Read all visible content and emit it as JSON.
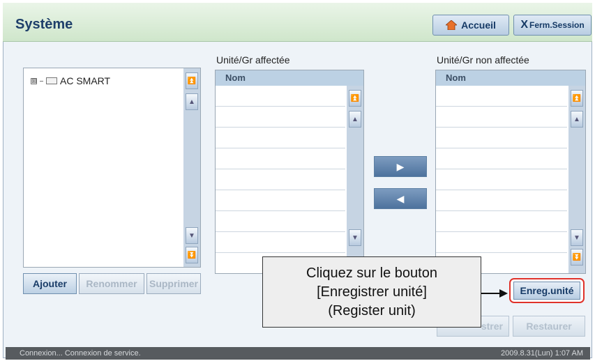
{
  "header": {
    "title": "Système",
    "home_label": "Accueil",
    "logout_prefix": "X",
    "logout_label": "Ferm.Session"
  },
  "tree": {
    "items": [
      {
        "label": "AC SMART",
        "expander": "⊞"
      }
    ]
  },
  "tree_buttons": {
    "add": "Ajouter",
    "rename": "Renommer",
    "delete": "Supprimer"
  },
  "assigned": {
    "label": "Unité/Gr affectée",
    "column": "Nom"
  },
  "unassigned": {
    "label": "Unité/Gr non affectée",
    "column": "Nom"
  },
  "move_buttons": {
    "right_icon": "▶",
    "left_icon": "◀"
  },
  "actions": {
    "register_unit": "Enreg.unité",
    "save_partial": "strer",
    "restore": "Restaurer"
  },
  "callout": {
    "line1": "Cliquez sur le bouton",
    "line2": "[Enregistrer unité]",
    "line3": "(Register unit)"
  },
  "status": {
    "left": "Connexion... Connexion de service.",
    "right": "2009.8.31(Lun)  1:07 AM"
  },
  "colors": {
    "highlight": "#e0322a",
    "title": "#1e3f6a",
    "header_bg": "#cfe6cb"
  }
}
